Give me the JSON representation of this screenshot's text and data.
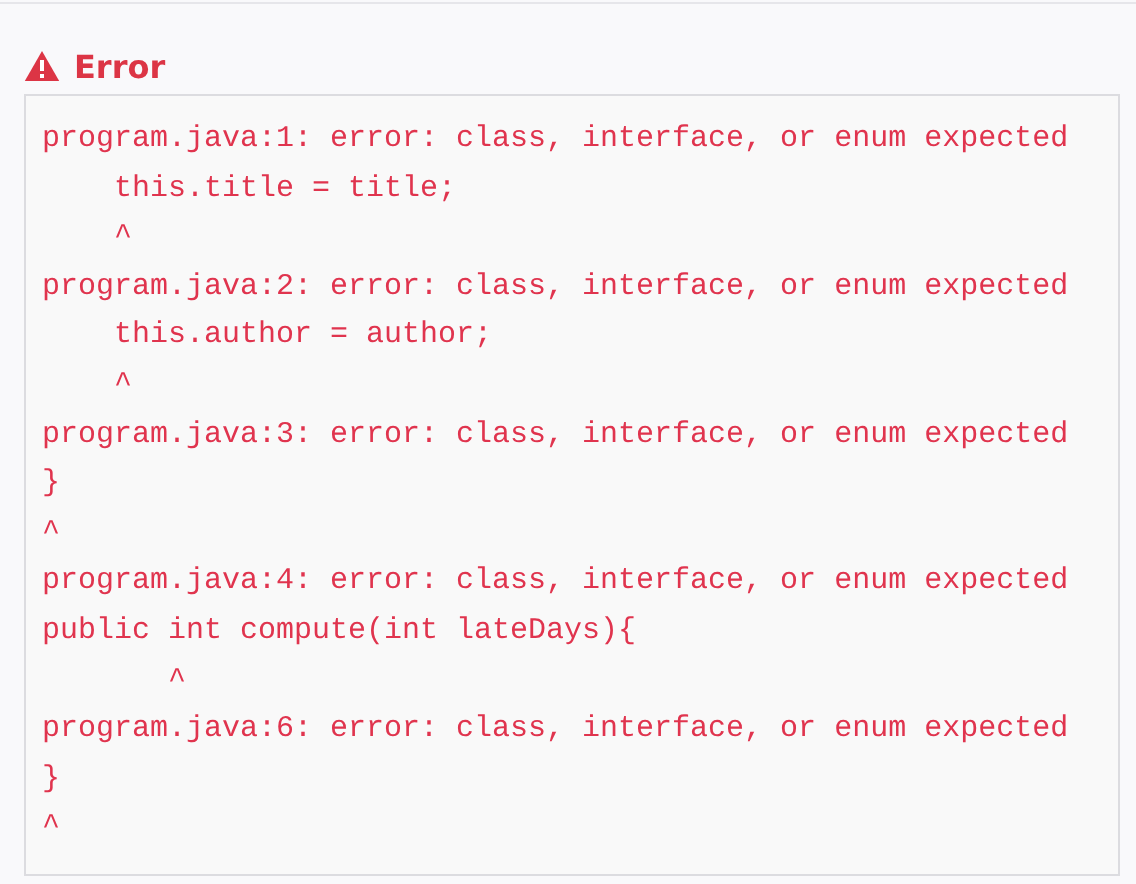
{
  "heading": "Error",
  "output_lines": [
    "program.java:1: error: class, interface, or enum expected",
    "    this.title = title;",
    "    ^",
    "program.java:2: error: class, interface, or enum expected",
    "    this.author = author;",
    "    ^",
    "program.java:3: error: class, interface, or enum expected",
    "}",
    "^",
    "program.java:4: error: class, interface, or enum expected",
    "public int compute(int lateDays){",
    "       ^",
    "program.java:6: error: class, interface, or enum expected",
    "}",
    "^"
  ]
}
